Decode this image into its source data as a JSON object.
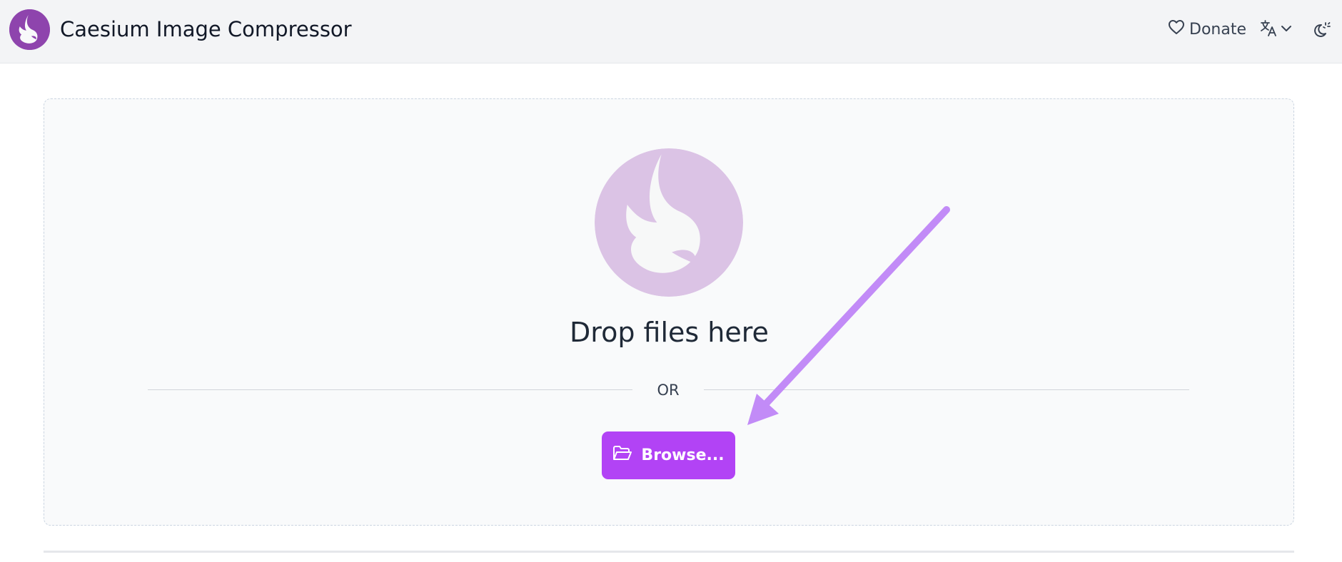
{
  "header": {
    "app_name_strong": "Caesium",
    "app_name_rest": " Image Compressor",
    "donate_label": "Donate",
    "icons": {
      "logo": "caesium-logo",
      "donate": "heart-icon",
      "language": "translate-icon",
      "language_dropdown": "chevron-down-icon",
      "theme": "theme-toggle-icon"
    }
  },
  "dropzone": {
    "title": "Drop files here",
    "separator": "OR",
    "browse_label": "Browse...",
    "browse_icon": "folder-open-icon"
  },
  "colors": {
    "brand_purple": "#8e44ad",
    "button_purple": "#b243f5",
    "annotation_arrow": "#c28bf7",
    "header_bg": "#f3f4f6",
    "dropzone_bg": "#f9fafb"
  }
}
